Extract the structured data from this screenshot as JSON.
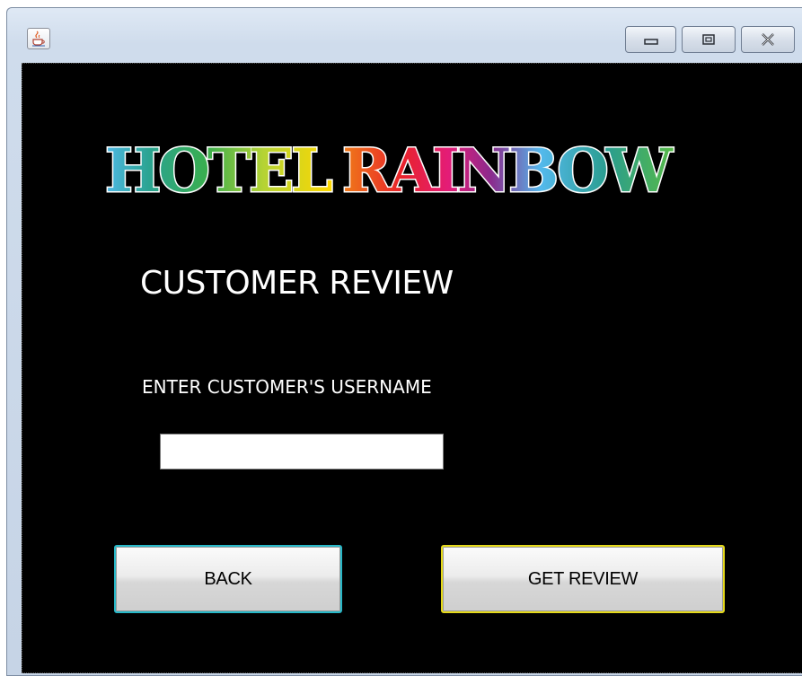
{
  "window": {
    "icon": "java-coffee-cup-icon",
    "controls": {
      "minimize": "minimize-icon",
      "maximize": "maximize-icon",
      "close": "close-icon"
    }
  },
  "logo": {
    "word1": "HOTEL",
    "word2": "RAINBOW",
    "colors": [
      "#4fb8e6",
      "#2aa38f",
      "#3aae4e",
      "#b5d334",
      "#ffd800",
      "#f07c18",
      "#e8232b",
      "#e41c77",
      "#8a2b8d",
      "#54b9ec",
      "#2a9d8f",
      "#56b947"
    ]
  },
  "heading": "CUSTOMER REVIEW",
  "form": {
    "label": "ENTER CUSTOMER'S USERNAME",
    "username_value": ""
  },
  "buttons": {
    "back": "BACK",
    "get_review": "GET REVIEW"
  },
  "colors": {
    "background": "#000000",
    "back_border": "#27b8c8",
    "review_border": "#e5d91a"
  }
}
